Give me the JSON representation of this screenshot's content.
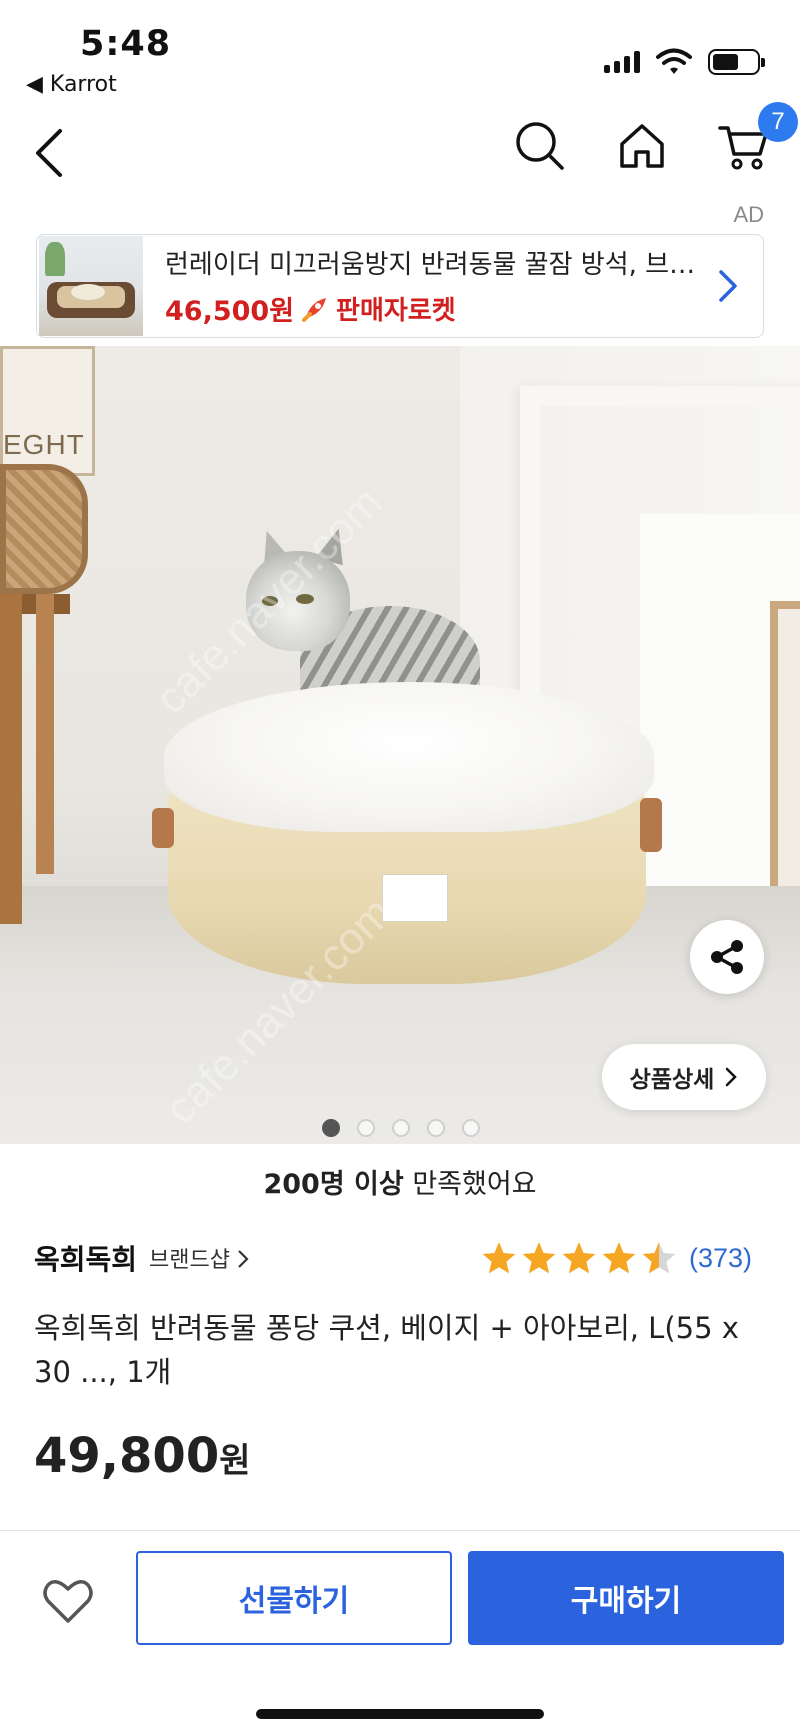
{
  "status_bar": {
    "time": "5:48",
    "back_app": "◀ Karrot"
  },
  "nav": {
    "back_icon": "chevron-left-icon",
    "search_icon": "search-icon",
    "home_icon": "home-icon",
    "cart_icon": "cart-icon",
    "cart_count": "7"
  },
  "ad": {
    "label": "AD",
    "title": "런레이더 미끄러움방지 반려동물 꿀잠 방석, 브라운",
    "price": "46,500원",
    "badge_label": "판매자로켓",
    "badge_icon": "rocket-icon"
  },
  "hero": {
    "watermark": "cafe.naver.com",
    "detail_button": "상품상세",
    "share_icon": "share-icon",
    "dots": [
      true,
      false,
      false,
      false,
      false
    ]
  },
  "product": {
    "satisfaction_bold": "200명 이상",
    "satisfaction_rest": " 만족했어요",
    "brand": "옥희독희",
    "brand_shop": "브랜드샵",
    "rating": 4.5,
    "review_count": "(373)",
    "title": "옥희독희 반려동물 퐁당 쿠션, 베이지 + 아아보리, L(55 x 30 ..., 1개",
    "price": "49,800",
    "price_unit": "원"
  },
  "bottom": {
    "gift_label": "선물하기",
    "buy_label": "구매하기"
  },
  "colors": {
    "accent_blue": "#2a63dd",
    "badge_blue": "#2e7bf0",
    "ad_red": "#d21f1f",
    "star_gold": "#f5a623"
  }
}
